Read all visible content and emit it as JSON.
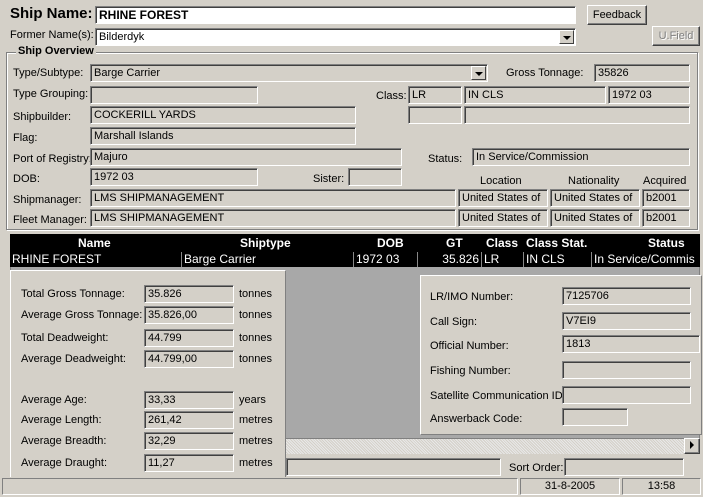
{
  "header": {
    "ship_name_label": "Ship Name:",
    "ship_name": "RHINE FOREST",
    "former_names_label": "Former Name(s):",
    "former_name": "Bilderdyk",
    "feedback_button": "Feedback",
    "ufield_button": "U.Field"
  },
  "overview": {
    "title": "Ship Overview",
    "type_label": "Type/Subtype:",
    "type_value": "Barge Carrier",
    "gross_tonnage_label": "Gross Tonnage:",
    "gross_tonnage": "35826",
    "type_grouping_label": "Type Grouping:",
    "type_grouping": "",
    "class_label": "Class:",
    "class_value": "LR",
    "class_status": "IN CLS",
    "class_date": "1972 03",
    "shipbuilder_label": "Shipbuilder:",
    "shipbuilder": "COCKERILL YARDS",
    "flag_label": "Flag:",
    "flag": "Marshall Islands",
    "port_label": "Port of Registry:",
    "port": "Majuro",
    "status_label": "Status:",
    "status": "In Service/Commission",
    "dob_label": "DOB:",
    "dob": "1972 03",
    "sister_label": "Sister:",
    "sister": "",
    "location_head": "Location",
    "nationality_head": "Nationality",
    "acquired_head": "Acquired",
    "shipmanager_label": "Shipmanager:",
    "shipmanager": "LMS SHIPMANAGEMENT",
    "shipmanager_location": "United States of",
    "shipmanager_nationality": "United States of",
    "shipmanager_acquired": "b2001",
    "fleet_manager_label": "Fleet Manager:",
    "fleet_manager": "LMS SHIPMANAGEMENT",
    "fleet_location": "United States of",
    "fleet_nationality": "United States of",
    "fleet_acquired": "b2001"
  },
  "grid": {
    "columns": [
      "Name",
      "Shiptype",
      "DOB",
      "GT",
      "Class",
      "Class Stat.",
      "Status"
    ],
    "row": [
      "RHINE FOREST",
      "Barge Carrier",
      "1972 03",
      "35.826",
      "LR",
      "IN CLS",
      "In Service/Commis"
    ]
  },
  "totals": {
    "total_gt_label": "Total Gross Tonnage:",
    "total_gt": "35.826",
    "avg_gt_label": "Average Gross Tonnage:",
    "avg_gt": "35.826,00",
    "total_dwt_label": "Total Deadweight:",
    "total_dwt": "44.799",
    "avg_dwt_label": "Average Deadweight:",
    "avg_dwt": "44.799,00",
    "unit_tonnes": "tonnes",
    "avg_age_label": "Average Age:",
    "avg_age": "33,33",
    "unit_years": "years",
    "avg_length_label": "Average Length:",
    "avg_length": "261,42",
    "avg_breadth_label": "Average Breadth:",
    "avg_breadth": "32,29",
    "avg_draught_label": "Average Draught:",
    "avg_draught": "11,27",
    "unit_metres": "metres"
  },
  "ids": {
    "imo_label": "LR/IMO Number:",
    "imo": "7125706",
    "callsign_label": "Call Sign:",
    "callsign": "V7EI9",
    "official_label": "Official Number:",
    "official": "1813",
    "fishing_label": "Fishing Number:",
    "fishing": "",
    "satcom_label": "Satellite Communication ID:",
    "satcom": "",
    "answerback_label": "Answerback Code:",
    "answerback": ""
  },
  "bottom": {
    "sort_order_label": "Sort Order:",
    "sort_order": ""
  },
  "statusbar": {
    "date": "31-8-2005",
    "time": "13:58"
  }
}
